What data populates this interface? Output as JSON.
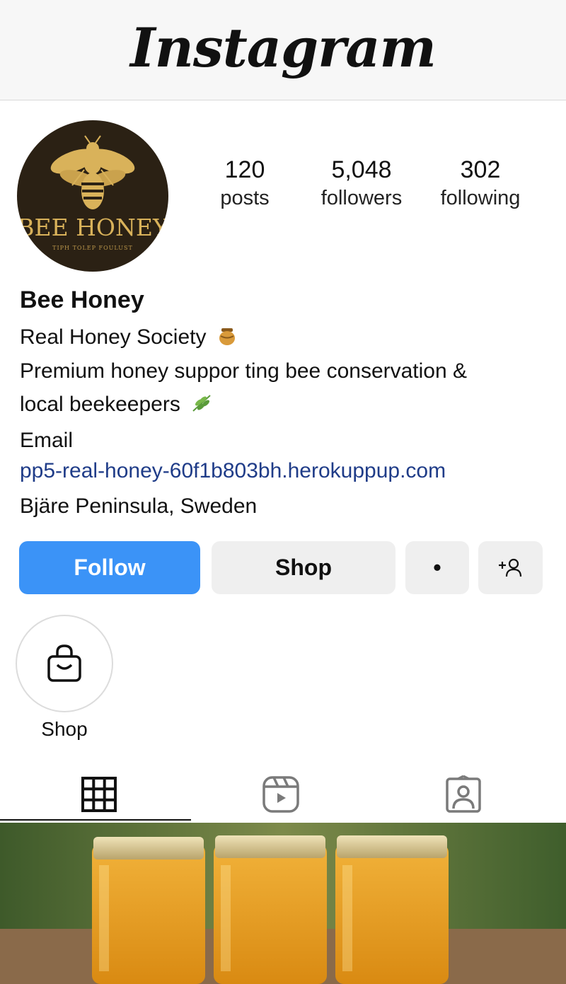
{
  "app": {
    "title": "Instagram"
  },
  "profile": {
    "logo_text": "BEE HONEY",
    "logo_subtext": "TIPH TOLEP FOULUST",
    "name": "Bee Honey",
    "stats": [
      {
        "value": "120",
        "label": "posts"
      },
      {
        "value": "5,048",
        "label": "followers"
      },
      {
        "value": "302",
        "label": "following"
      }
    ],
    "bio": {
      "line1": "Real Honey Society",
      "line2": "Premium honey suppor ting bee conservation &",
      "line3": "local beekeepers",
      "email_label": "Email",
      "link": "pp5-real-honey-60f1b803bh.herokuppup.com",
      "location": "Bjäre Peninsula, Sweden"
    }
  },
  "actions": {
    "follow_label": "Follow",
    "shop_label": "Shop",
    "more_label": "•"
  },
  "highlights": [
    {
      "label": "Shop",
      "icon": "shopping-bag-icon"
    }
  ],
  "tabs": [
    {
      "icon": "grid-icon",
      "active": true
    },
    {
      "icon": "reels-icon",
      "active": false
    },
    {
      "icon": "tagged-icon",
      "active": false
    }
  ],
  "colors": {
    "follow_button": "#3b93f7",
    "link": "#1f3c88",
    "logo_gold": "#d9b25a",
    "logo_bg": "#2b2114"
  }
}
